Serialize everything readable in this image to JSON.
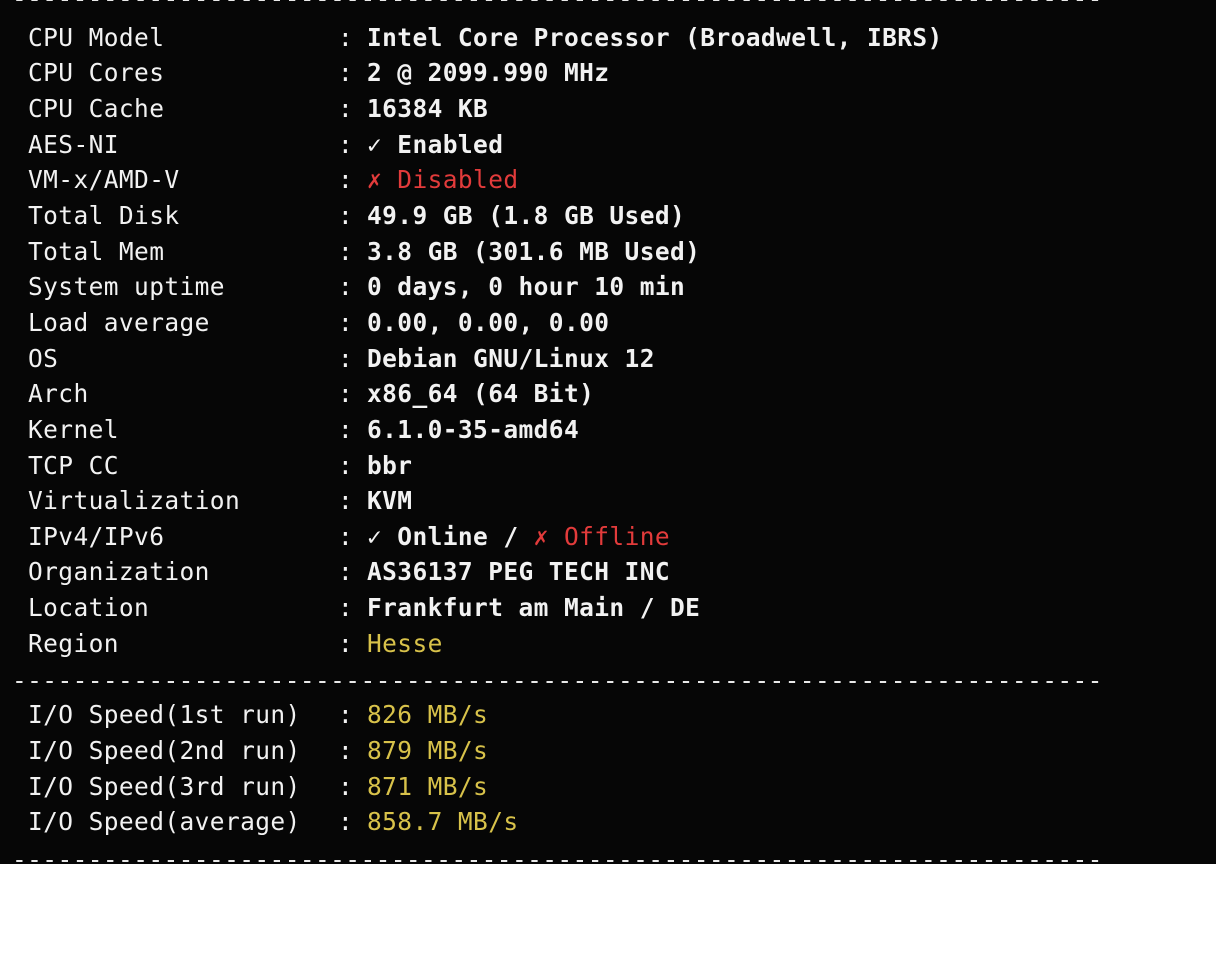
{
  "separator": "--------------------------------------------------------------------------------",
  "colon": ":",
  "system_info": [
    {
      "key": "CPU Model",
      "value": "Intel Core Processor (Broadwell, IBRS)"
    },
    {
      "key": "CPU Cores",
      "value": "2 @ 2099.990 MHz"
    },
    {
      "key": "CPU Cache",
      "value": "16384 KB"
    },
    {
      "key": "AES-NI",
      "value": "✓ Enabled"
    },
    {
      "key": "VM-x/AMD-V",
      "value": "✗ Disabled",
      "status_color": "#e23b3b"
    },
    {
      "key": "Total Disk",
      "value": "49.9 GB (1.8 GB Used)"
    },
    {
      "key": "Total Mem",
      "value": "3.8 GB (301.6 MB Used)"
    },
    {
      "key": "System uptime",
      "value": "0 days, 0 hour 10 min"
    },
    {
      "key": "Load average",
      "value": "0.00, 0.00, 0.00"
    },
    {
      "key": "OS",
      "value": "Debian GNU/Linux 12"
    },
    {
      "key": "Arch",
      "value": "x86_64 (64 Bit)"
    },
    {
      "key": "Kernel",
      "value": "6.1.0-35-amd64"
    },
    {
      "key": "TCP CC",
      "value": "bbr"
    },
    {
      "key": "Virtualization",
      "value": "KVM"
    },
    {
      "key": "IPv4/IPv6",
      "value_online": "✓ Online /",
      "value_offline": "✗ Offline",
      "offline_color": "#e23b3b"
    },
    {
      "key": "Organization",
      "value": "AS36137 PEG TECH INC"
    },
    {
      "key": "Location",
      "value": "Frankfurt am Main / DE"
    },
    {
      "key": "Region",
      "value": "Hesse",
      "status_color": "#d8c24a"
    }
  ],
  "io_speed": [
    {
      "key": "I/O Speed(1st run)",
      "value": "826 MB/s"
    },
    {
      "key": "I/O Speed(2nd run)",
      "value": "879 MB/s"
    },
    {
      "key": "I/O Speed(3rd run)",
      "value": "871 MB/s"
    },
    {
      "key": "I/O Speed(average)",
      "value": "858.7 MB/s"
    }
  ],
  "colors": {
    "background": "#060606",
    "text": "#f2f2f2",
    "error": "#e23b3b",
    "highlight": "#d8c24a"
  }
}
